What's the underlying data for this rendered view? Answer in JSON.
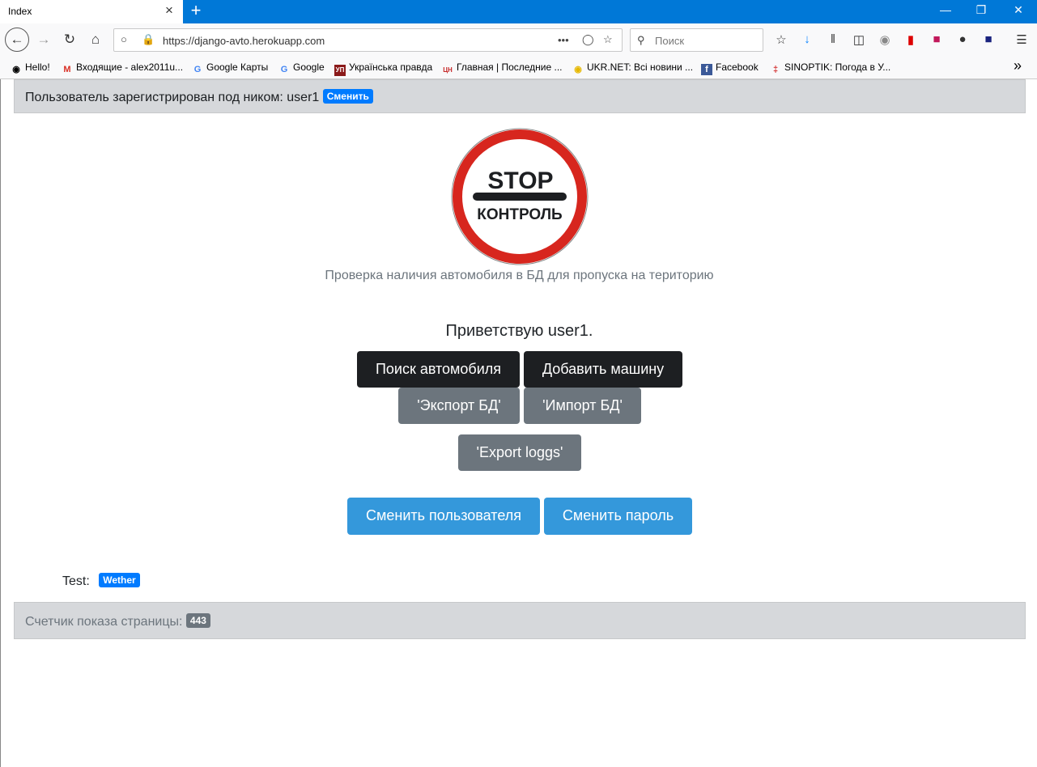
{
  "browser": {
    "tab_title": "Index",
    "tab_close": "×",
    "new_tab": "+",
    "url": "https://django-avto.herokuapp.com",
    "url_more": "•••",
    "search_placeholder": "Поиск",
    "bookmarks": [
      {
        "label": "Hello!",
        "icon": "globe-icon"
      },
      {
        "label": "Входящие - alex2011u...",
        "icon": "gmail-icon"
      },
      {
        "label": "Google Карты",
        "icon": "google-icon"
      },
      {
        "label": "Google",
        "icon": "google-icon"
      },
      {
        "label": "Українська правда",
        "icon": "up-icon"
      },
      {
        "label": "Главная | Последние ...",
        "icon": "cn-icon"
      },
      {
        "label": "UKR.NET: Всі новини ...",
        "icon": "ukrnet-icon"
      },
      {
        "label": "Facebook",
        "icon": "facebook-icon"
      },
      {
        "label": "SINOPTIK: Погода в У...",
        "icon": "thermometer-icon"
      }
    ],
    "bookmarks_overflow": "»"
  },
  "header": {
    "registered_text": "Пользователь зарегистрирован под ником: user1",
    "change_badge": "Сменить"
  },
  "logo": {
    "top_text": "STOP",
    "bottom_text": "КОНТРОЛЬ",
    "ring_color": "#d7261e"
  },
  "main": {
    "subtitle": "Проверка наличия автомобиля в БД для пропуска на територию",
    "greeting": "Приветствую user1.",
    "buttons": {
      "search": "Поиск автомобиля",
      "add": "Добавить машину",
      "export_db": "'Экспорт БД'",
      "import_db": "'Импорт БД'",
      "export_logs": "'Export loggs'",
      "change_user": "Сменить пользователя",
      "change_password": "Сменить пароль"
    },
    "test_label": "Test:",
    "weather_badge": "Wether"
  },
  "footer": {
    "counter_label": "Счетчик показа страницы:",
    "counter_value": "443"
  },
  "colors": {
    "browser_accent": "#0078d7",
    "dark_button": "#1d1f22",
    "gray_button": "#6c757d",
    "blue_button": "#3498db",
    "badge_blue": "#007bff"
  }
}
